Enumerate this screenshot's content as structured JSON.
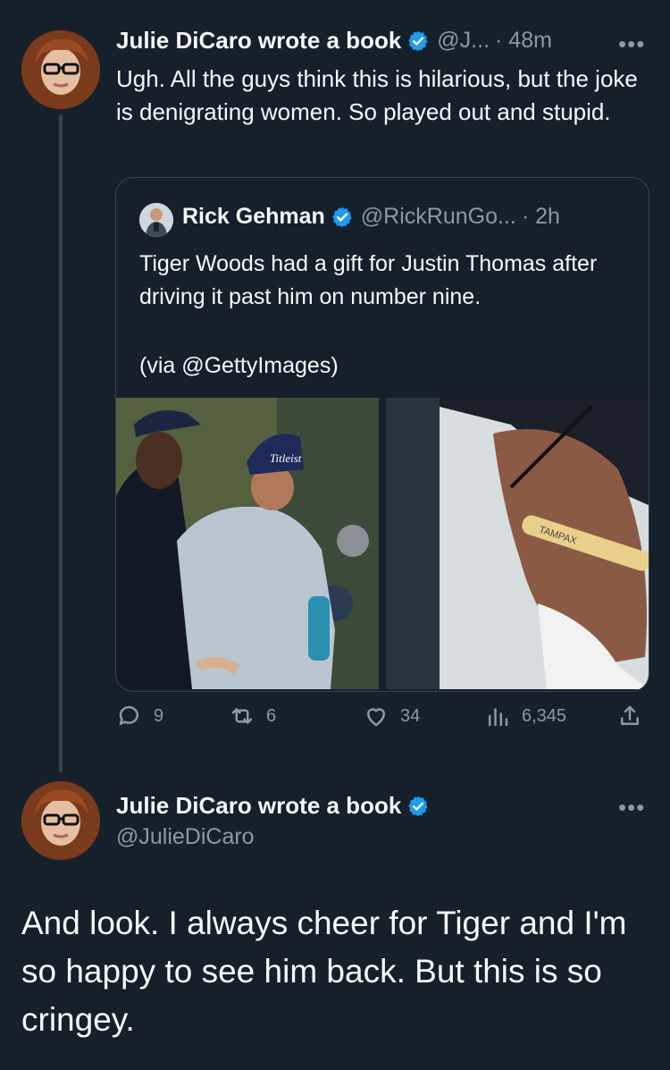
{
  "first_tweet": {
    "author_name": "Julie DiCaro wrote a book",
    "handle": "@J...",
    "time": "· 48m",
    "more": "•••",
    "text": "Ugh. All the guys think this is hilarious, but the joke is denigrating women. So played out and stupid."
  },
  "quoted_tweet": {
    "author_name": "Rick Gehman",
    "handle": "@RickRunGo...",
    "time": "· 2h",
    "text_line1": "Tiger Woods had a gift for Justin Thomas after driving it past him on number nine.",
    "text_line2": "(via @GettyImages)",
    "photo_left_cap_text": "Titleist",
    "photo_right_marker_text": "TAMPAX"
  },
  "actions": {
    "replies": "9",
    "retweets": "6",
    "likes": "34",
    "views": "6,345"
  },
  "main_tweet": {
    "author_name": "Julie DiCaro wrote a book",
    "handle": "@JulieDiCaro",
    "more": "•••",
    "text": "And look. I always cheer for Tiger and I'm so happy to see him back. But this is so cringey."
  },
  "colors": {
    "background": "#15202b",
    "verified": "#1d9bf0",
    "secondary_text": "#8b98a5",
    "border": "#38444d"
  }
}
